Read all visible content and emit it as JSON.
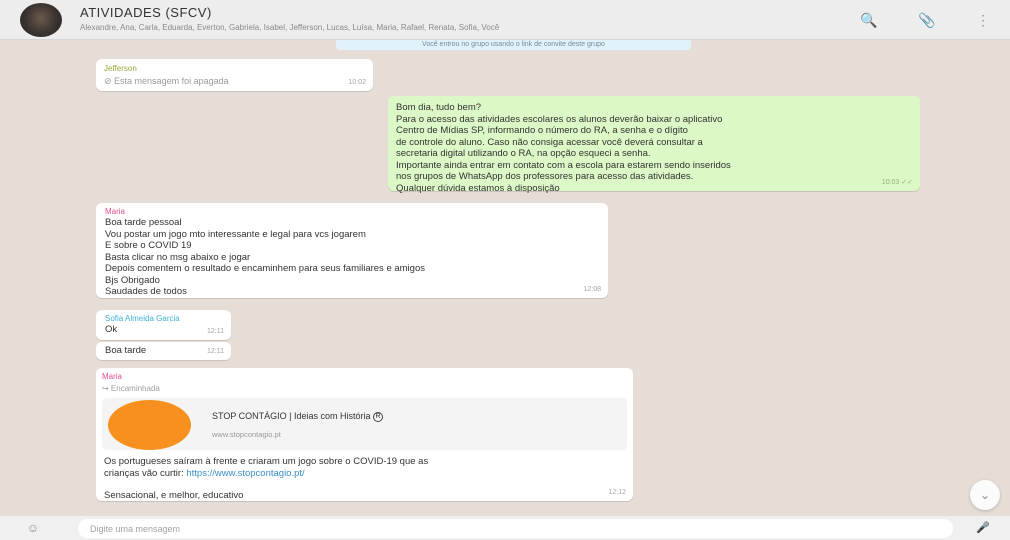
{
  "header": {
    "title": "ATIVIDADES (SFCV)",
    "members": "Alexandre, Ana, Carla, Eduarda, Everton, Gabriela, Isabel, Jefferson, Lucas, Luísa, Maria, Rafael, Renata, Sofia, Você",
    "search_icon": "🔍",
    "attach_icon": "📎",
    "menu_icon": "⋮"
  },
  "system_message": "Você entrou no grupo usando o link de convite deste grupo",
  "messages": {
    "m1": {
      "sender": "Jefferson",
      "text": "⊘ Esta mensagem foi apagada",
      "time": "10:02"
    },
    "m2": {
      "lines": [
        "Bom dia, tudo bem?",
        "Para o acesso das atividades escolares os alunos deverão baixar o aplicativo",
        "Centro de Mídias SP, informando o número do RA, a senha e o dígito",
        "de controle do aluno. Caso não consiga acessar você deverá consultar a",
        "secretaria digital utilizando o RA, na opção esqueci a senha.",
        "Importante ainda entrar em contato com a escola para estarem sendo inseridos",
        "nos grupos de WhatsApp dos professores para acesso das atividades.",
        "Qualquer dúvida estamos à disposição"
      ],
      "time": "10:03 ✓✓"
    },
    "m3": {
      "sender": "Maria",
      "lines": [
        "Boa tarde pessoal",
        "Vou postar um jogo mto interessante e legal para vcs jogarem",
        "E sobre o COVID 19",
        "Basta clicar no msg abaixo e jogar",
        "Depois comentem o resultado e encaminhem para seus familiares e amigos",
        "Bjs Obrigado",
        "Saudades de todos"
      ],
      "time": "12:08"
    },
    "m4": {
      "sender": "Sofia Almeida Garcia",
      "text": "Ok",
      "time": "12:11"
    },
    "m6": {
      "text": "Boa tarde",
      "time": "12:11"
    },
    "m5": {
      "sender": "Maria",
      "forwarded": "↪ Encaminhada",
      "preview_title": "STOP CONTÁGIO | Ideias com História",
      "preview_mark": "R",
      "preview_url": "www.stopcontagio.pt",
      "line1": "Os portugueses saíram à frente e criaram um jogo sobre o COVID-19 que as",
      "line2_prefix": "crianças vão curtir: ",
      "link": "https://www.stopcontagio.pt/",
      "line3": "Sensacional, e melhor, educativo",
      "time": "12:12"
    }
  },
  "scroll_icon": "⌄",
  "footer": {
    "emoji_icon": "☺",
    "placeholder": "Digite uma mensagem",
    "mic_icon": "🎤"
  }
}
